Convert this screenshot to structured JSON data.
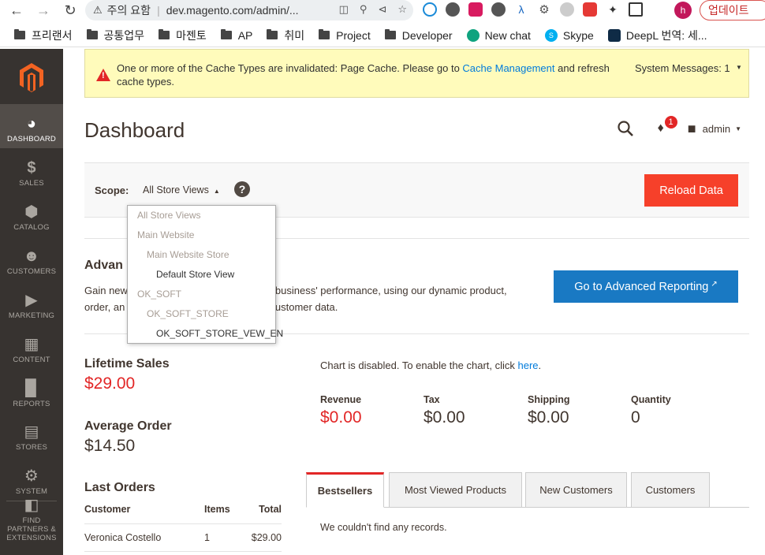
{
  "browser": {
    "warning_label": "주의 요함",
    "url": "dev.magento.com/admin/...",
    "update_label": "업데이트",
    "profile_initial": "h"
  },
  "bookmarks": [
    {
      "label": "프리랜서",
      "icon": "folder-icon"
    },
    {
      "label": "공통업무",
      "icon": "folder-icon"
    },
    {
      "label": "마젠토",
      "icon": "folder-icon"
    },
    {
      "label": "AP",
      "icon": "folder-icon"
    },
    {
      "label": "취미",
      "icon": "folder-icon"
    },
    {
      "label": "Project",
      "icon": "folder-icon"
    },
    {
      "label": "Developer",
      "icon": "folder-icon"
    },
    {
      "label": "New chat",
      "icon": "openai-icon"
    },
    {
      "label": "Skype",
      "icon": "skype-icon"
    },
    {
      "label": "DeepL 번역: 세...",
      "icon": "deepl-icon"
    }
  ],
  "sidebar": {
    "items": [
      {
        "label": "DASHBOARD",
        "icon": "dashboard-icon"
      },
      {
        "label": "SALES",
        "icon": "dollar-icon"
      },
      {
        "label": "CATALOG",
        "icon": "box-icon"
      },
      {
        "label": "CUSTOMERS",
        "icon": "person-icon"
      },
      {
        "label": "MARKETING",
        "icon": "megaphone-icon"
      },
      {
        "label": "CONTENT",
        "icon": "layout-icon"
      },
      {
        "label": "REPORTS",
        "icon": "bar-chart-icon"
      },
      {
        "label": "STORES",
        "icon": "store-icon"
      },
      {
        "label": "SYSTEM",
        "icon": "gear-icon"
      },
      {
        "label": "FIND PARTNERS & EXTENSIONS",
        "icon": "extensions-icon"
      }
    ]
  },
  "system_message": {
    "text_before": "One or more of the Cache Types are invalidated: Page Cache. Please go to ",
    "link": "Cache Management",
    "text_after": " and refresh cache types.",
    "count_label": "System Messages: 1"
  },
  "header": {
    "title": "Dashboard",
    "notification_count": "1",
    "user": "admin"
  },
  "scope": {
    "label": "Scope:",
    "selected": "All Store Views",
    "reload_label": "Reload Data",
    "options": [
      "All Store Views",
      "Main Website",
      "Main Website Store",
      "Default Store View",
      "OK_SOFT",
      "OK_SOFT_STORE",
      "OK_SOFT_STORE_VEW_EN"
    ]
  },
  "advanced": {
    "title": "Advan",
    "line1_a": "Gain new",
    "line1_b": "your business' performance, using our dynamic product,",
    "line2_a": "order, an",
    "line2_b": "our customer data.",
    "button_label": "Go to Advanced Reporting"
  },
  "stats": {
    "lifetime_label": "Lifetime Sales",
    "lifetime_value": "$29.00",
    "avg_label": "Average Order",
    "avg_value": "$14.50",
    "orders_label": "Last Orders"
  },
  "chart": {
    "disabled_text": "Chart is disabled. To enable the chart, click ",
    "link": "here",
    "period": "."
  },
  "totals": [
    {
      "label": "Revenue",
      "value": "$0.00",
      "color": "#e22626"
    },
    {
      "label": "Tax",
      "value": "$0.00",
      "color": "#41362f"
    },
    {
      "label": "Shipping",
      "value": "$0.00",
      "color": "#41362f"
    },
    {
      "label": "Quantity",
      "value": "0",
      "color": "#41362f"
    }
  ],
  "orders": {
    "columns": [
      "Customer",
      "Items",
      "Total"
    ],
    "rows": [
      {
        "customer": "Veronica Costello",
        "items": "1",
        "total": "$29.00"
      }
    ]
  },
  "tabs": [
    "Bestsellers",
    "Most Viewed Products",
    "New Customers",
    "Customers"
  ],
  "no_records": "We couldn't find any records."
}
